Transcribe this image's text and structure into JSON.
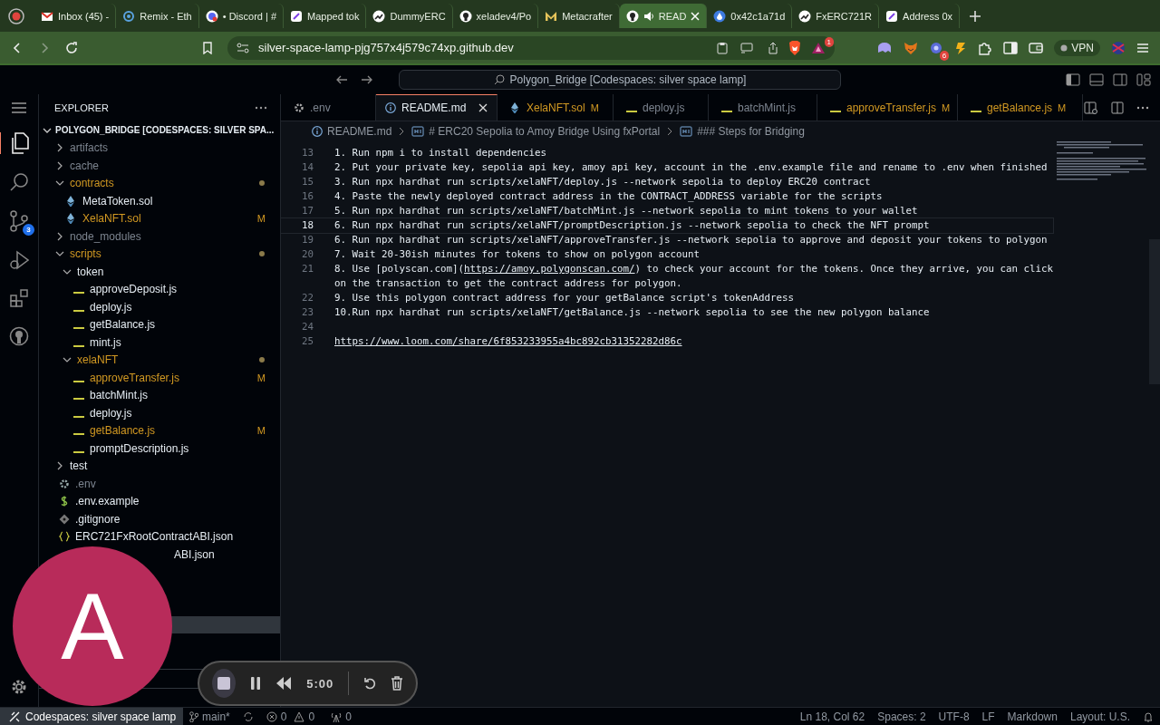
{
  "browser": {
    "tabs": [
      {
        "label": "Inbox (45) -",
        "selected": false
      },
      {
        "label": "Remix - Eth",
        "selected": false
      },
      {
        "label": "• Discord | #",
        "selected": false
      },
      {
        "label": "Mapped tok",
        "selected": false
      },
      {
        "label": "DummyERC",
        "selected": false
      },
      {
        "label": "xeladev4/Po",
        "selected": false
      },
      {
        "label": "Metacrafter",
        "selected": false
      },
      {
        "label": "READ",
        "selected": true
      },
      {
        "label": "0x42c1a71d",
        "selected": false
      },
      {
        "label": "FxERC721R",
        "selected": false
      },
      {
        "label": "Address 0x",
        "selected": false
      }
    ],
    "address": "silver-space-lamp-pjg757x4j579c74xp.github.dev",
    "rewards_badge": "1",
    "extension_badge": "6",
    "vpn_label": "VPN"
  },
  "command_center": "Polygon_Bridge [Codespaces: silver space lamp]",
  "activity_bar": {
    "source_control_badge": "3"
  },
  "explorer": {
    "title": "EXPLORER",
    "root": "POLYGON_BRIDGE [CODESPACES: SILVER SPA...",
    "tree": [
      {
        "label": "artifacts",
        "kind": "folder",
        "expanded": false,
        "ignored": true
      },
      {
        "label": "cache",
        "kind": "folder",
        "expanded": false,
        "ignored": true
      },
      {
        "label": "contracts",
        "kind": "folder",
        "expanded": true,
        "changed": true,
        "children": [
          {
            "label": "MetaToken.sol",
            "kind": "sol"
          },
          {
            "label": "XelaNFT.sol",
            "kind": "sol",
            "modified": true,
            "badge": "M"
          }
        ]
      },
      {
        "label": "node_modules",
        "kind": "folder",
        "expanded": false,
        "ignored": true
      },
      {
        "label": "scripts",
        "kind": "folder",
        "expanded": true,
        "changed": true,
        "children": [
          {
            "label": "token",
            "kind": "folder",
            "expanded": true,
            "children": [
              {
                "label": "approveDeposit.js",
                "kind": "js"
              },
              {
                "label": "deploy.js",
                "kind": "js"
              },
              {
                "label": "getBalance.js",
                "kind": "js"
              },
              {
                "label": "mint.js",
                "kind": "js"
              }
            ]
          },
          {
            "label": "xelaNFT",
            "kind": "folder",
            "expanded": true,
            "changed": true,
            "children": [
              {
                "label": "approveTransfer.js",
                "kind": "js",
                "modified": true,
                "badge": "M"
              },
              {
                "label": "batchMint.js",
                "kind": "js"
              },
              {
                "label": "deploy.js",
                "kind": "js"
              },
              {
                "label": "getBalance.js",
                "kind": "js",
                "modified": true,
                "badge": "M"
              },
              {
                "label": "promptDescription.js",
                "kind": "js"
              }
            ]
          }
        ]
      },
      {
        "label": "test",
        "kind": "folder",
        "expanded": false
      },
      {
        "label": ".env",
        "kind": "env",
        "ignored": true
      },
      {
        "label": ".env.example",
        "kind": "shell"
      },
      {
        "label": ".gitignore",
        "kind": "git"
      },
      {
        "label": "ERC721FxRootContractABI.json",
        "kind": "json"
      },
      {
        "label": "ABI.json",
        "kind": "json",
        "covered": true
      }
    ]
  },
  "editor": {
    "tabs": [
      {
        "label": ".env",
        "kind": "env",
        "selected": false
      },
      {
        "label": "README.md",
        "kind": "info",
        "selected": true
      },
      {
        "label": "XelaNFT.sol",
        "kind": "sol",
        "selected": false,
        "modified": true,
        "badge": "M"
      },
      {
        "label": "deploy.js",
        "kind": "js",
        "selected": false
      },
      {
        "label": "batchMint.js",
        "kind": "js",
        "selected": false
      },
      {
        "label": "approveTransfer.js",
        "kind": "js",
        "selected": false,
        "modified": true,
        "badge": "M"
      },
      {
        "label": "getBalance.js",
        "kind": "js",
        "selected": false,
        "modified": true,
        "badge": "M"
      }
    ],
    "breadcrumbs": [
      "README.md",
      "# ERC20 Sepolia to Amoy Bridge Using fxPortal",
      "### Steps for Bridging"
    ],
    "lines": [
      {
        "number": "13",
        "current": false,
        "parts": [
          {
            "kind": "text",
            "text": "1. Run npm i to install dependencies"
          }
        ]
      },
      {
        "number": "14",
        "current": false,
        "parts": [
          {
            "kind": "text",
            "text": "2. Put your private key, sepolia api key, amoy api key, account in the .env.example file and rename to .env when finished"
          }
        ]
      },
      {
        "number": "15",
        "current": false,
        "parts": [
          {
            "kind": "text",
            "text": "3. Run npx hardhat run scripts/xelaNFT/deploy.js --network sepolia to deploy ERC20 contract"
          }
        ]
      },
      {
        "number": "16",
        "current": false,
        "parts": [
          {
            "kind": "text",
            "text": "4. Paste the newly deployed contract address in the CONTRACT_ADDRESS variable for the scripts"
          }
        ]
      },
      {
        "number": "17",
        "current": false,
        "parts": [
          {
            "kind": "text",
            "text": "5. Run npx hardhat run scripts/xelaNFT/batchMint.js --network sepolia to mint tokens to your wallet"
          }
        ]
      },
      {
        "number": "18",
        "current": true,
        "parts": [
          {
            "kind": "text",
            "text": "6. Run npx hardhat run scripts/xelaNFT/promptDescription.js --network sepolia to check the NFT prompt"
          }
        ]
      },
      {
        "number": "19",
        "current": false,
        "parts": [
          {
            "kind": "text",
            "text": "6. Run npx hardhat run scripts/xelaNFT/approveTransfer.js --network sepolia to approve and deposit your tokens to polygon"
          }
        ]
      },
      {
        "number": "20",
        "current": false,
        "parts": [
          {
            "kind": "text",
            "text": "7. Wait 20-30ish minutes for tokens to show on polygon account"
          }
        ]
      },
      {
        "number": "21",
        "current": false,
        "parts": [
          {
            "kind": "text",
            "text": "8. Use [polyscan.com]("
          },
          {
            "kind": "link",
            "text": "https://amoy.polygonscan.com/"
          },
          {
            "kind": "text",
            "text": ") to check your account for the tokens. Once they arrive, you can click on the transaction to get the contract address for polygon."
          }
        ]
      },
      {
        "number": "22",
        "current": false,
        "parts": [
          {
            "kind": "text",
            "text": "9. Use this polygon contract address for your getBalance script's tokenAddress"
          }
        ]
      },
      {
        "number": "23",
        "current": false,
        "parts": [
          {
            "kind": "text",
            "text": "10.Run npx hardhat run scripts/xelaNFT/getBalance.js --network sepolia to see the new polygon balance"
          }
        ]
      },
      {
        "number": "24",
        "current": false
      },
      {
        "number": "25",
        "current": false,
        "parts": [
          {
            "kind": "link",
            "text": "https://www.loom.com/share/6f853233955a4bc892cb31352282d86c"
          }
        ]
      }
    ]
  },
  "status_bar": {
    "remote": "Codespaces: silver space lamp",
    "branch": "main*",
    "errors": "0",
    "warnings": "0",
    "ports": "0",
    "right": [
      "Ln 18, Col 62",
      "Spaces: 2",
      "UTF-8",
      "LF",
      "Markdown",
      "Layout: U.S."
    ]
  },
  "overlay": {
    "avatar_letter": "A",
    "recorder_time": "5:00"
  }
}
